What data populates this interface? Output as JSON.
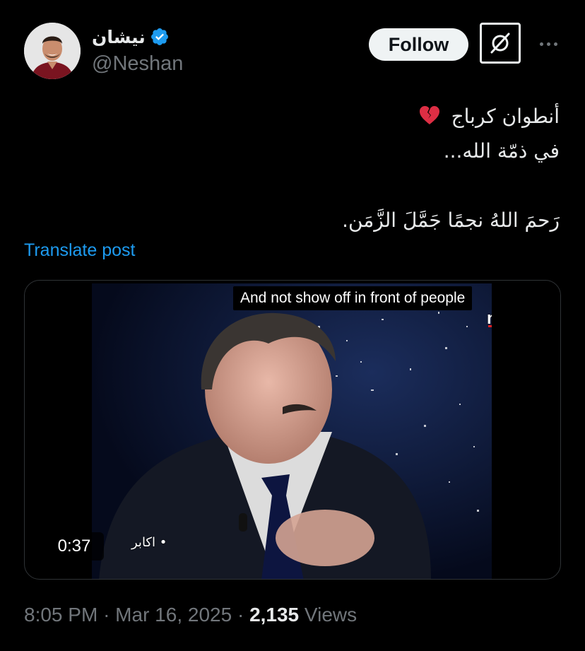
{
  "author": {
    "display_name": "نيشان",
    "handle": "@Neshan",
    "verified": true,
    "verified_color": "#1d9bf0"
  },
  "actions": {
    "follow_label": "Follow",
    "grok_icon": "grok-icon",
    "more_icon": "more-horizontal-icon"
  },
  "post": {
    "lines": [
      "أنطوان كرباج",
      "في ذمّة الله...",
      "",
      "رَحمَ اللهُ  نجمًا جَمَّلَ الزَّمَن."
    ],
    "emoji": "broken-heart-icon",
    "translate_label": "Translate post"
  },
  "media": {
    "caption": "And not show off in front of people",
    "channel_logo": "mtv",
    "show_name": "• اكابر",
    "duration": "0:37"
  },
  "meta": {
    "time": "8:05 PM",
    "separator": "·",
    "date": "Mar 16, 2025",
    "views_count": "2,135",
    "views_label": "Views"
  },
  "colors": {
    "background": "#000000",
    "text": "#e7e9ea",
    "secondary": "#71767b",
    "link": "#1d9bf0",
    "follow_bg": "#eff3f4"
  }
}
